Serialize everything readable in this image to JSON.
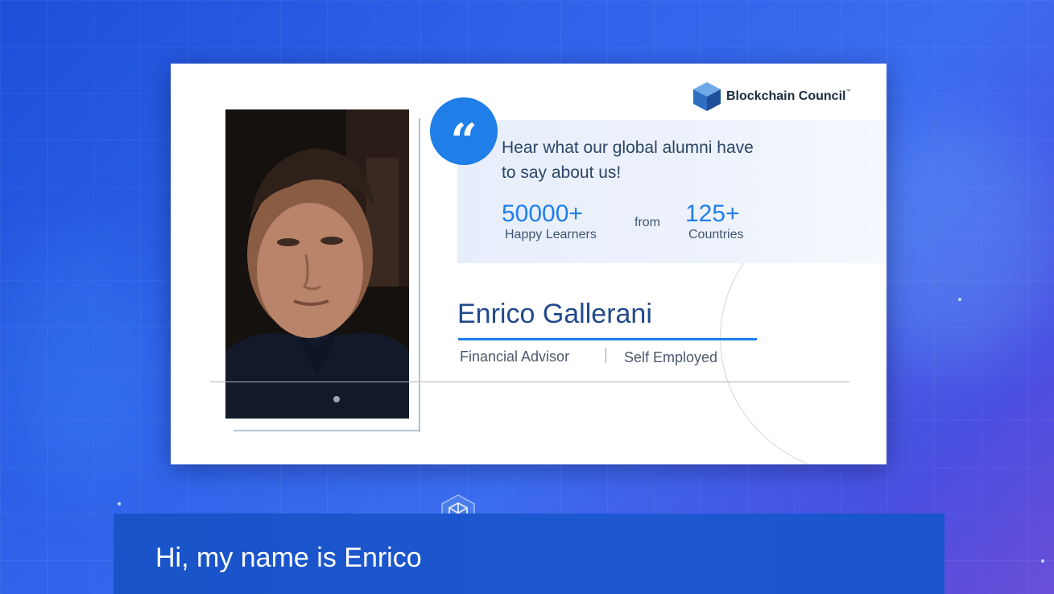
{
  "brand": {
    "name": "Blockchain Council",
    "trademark": "™",
    "logo_icon": "cube-logo-icon"
  },
  "testimonial": {
    "quote_icon": "quote-mark-icon",
    "quote_glyph": "“",
    "headline": "Hear what our global alumni have to say about us!",
    "stats": {
      "learners_value": "50000+",
      "learners_label": "Happy Learners",
      "connector": "from",
      "countries_value": "125+",
      "countries_label": "Countries"
    },
    "person": {
      "name": "Enrico Gallerani",
      "role": "Financial Advisor",
      "company": "Self Employed"
    }
  },
  "subtitle": {
    "text": "Hi, my name is Enrico"
  },
  "colors": {
    "accent": "#1f7ee8",
    "name_text": "#214a8c",
    "background": "#2f63ea",
    "caption_bar": "#1a53c8"
  }
}
